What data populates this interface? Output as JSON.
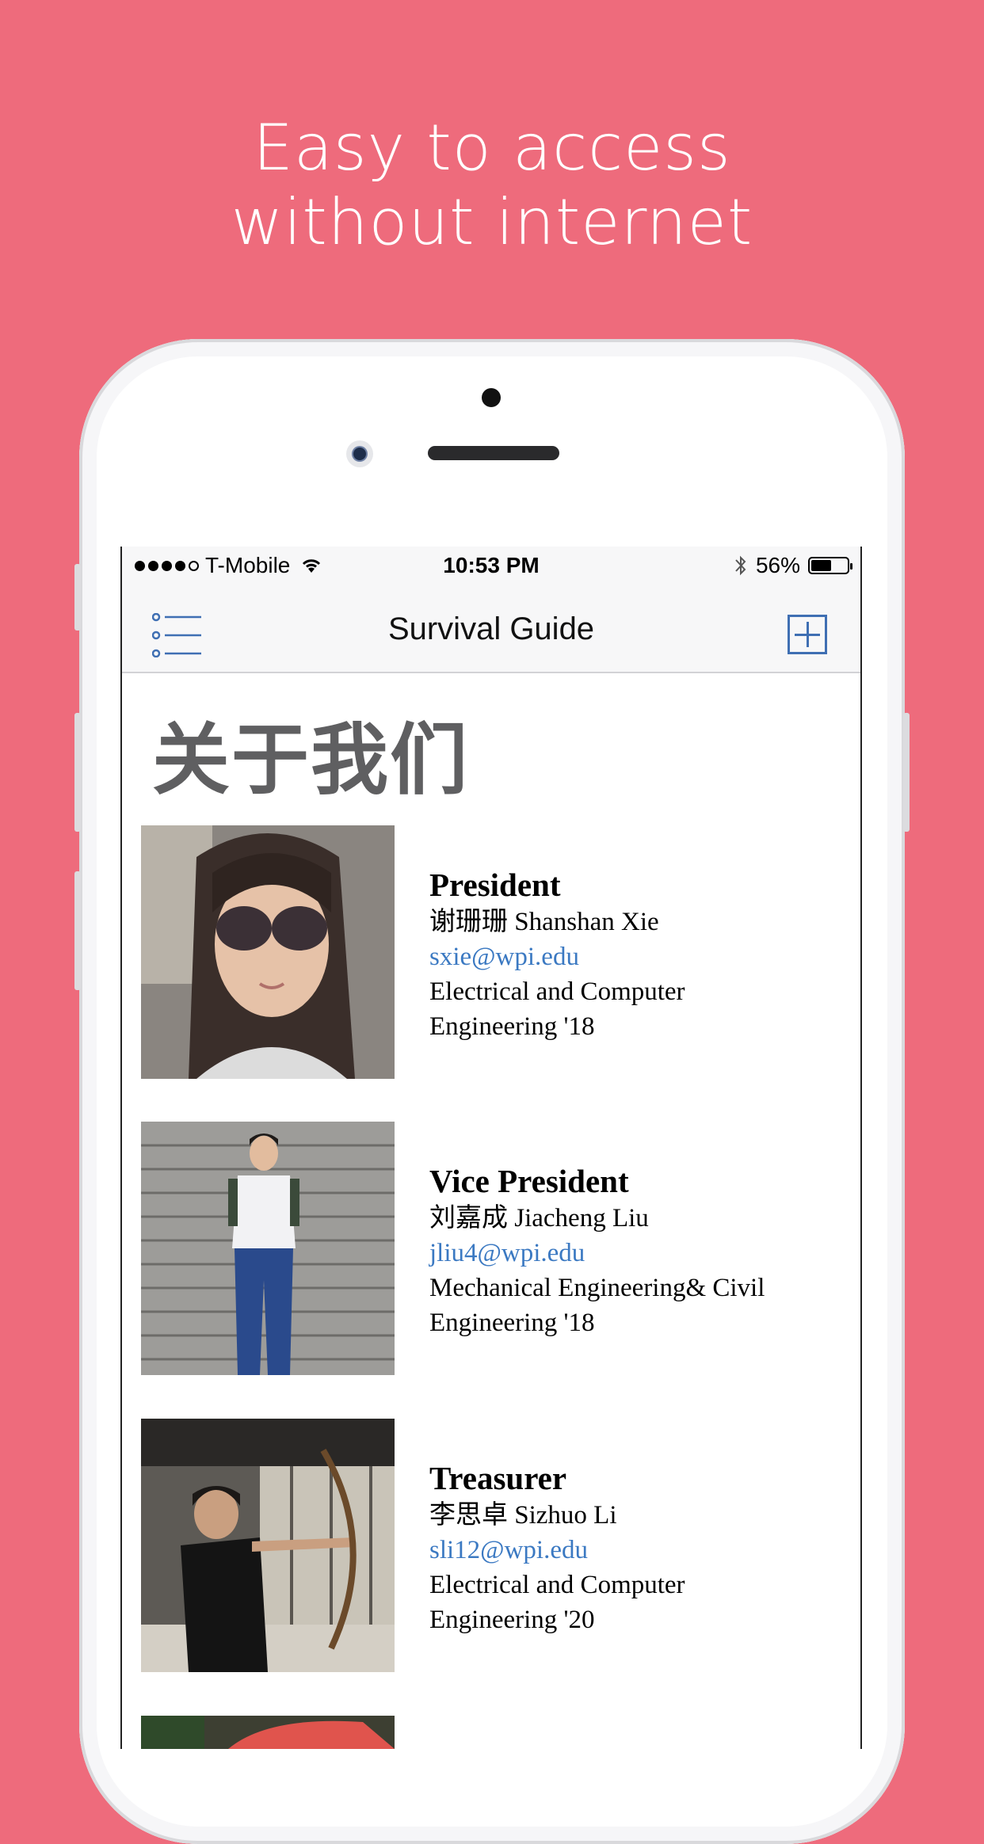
{
  "headline": {
    "line1": "Easy to access",
    "line2": "without internet"
  },
  "status_bar": {
    "carrier": "T-Mobile",
    "time": "10:53 PM",
    "battery_percent": "56%",
    "battery_level": 0.56,
    "signal_bars_filled": 4,
    "signal_bars_total": 5
  },
  "nav": {
    "title": "Survival Guide",
    "left_icon": "list-menu-icon",
    "right_icon": "add-square-icon"
  },
  "page": {
    "title": "关于我们"
  },
  "members": [
    {
      "role": "President",
      "name": "谢珊珊 Shanshan Xie",
      "email": "sxie@wpi.edu",
      "major_line1": "Electrical and Computer",
      "major_line2": "Engineering '18"
    },
    {
      "role": "Vice President",
      "name": "刘嘉成 Jiacheng Liu",
      "email": "jliu4@wpi.edu",
      "major_line1": "Mechanical Engineering& Civil",
      "major_line2": "Engineering '18"
    },
    {
      "role": "Treasurer",
      "name": "李思卓 Sizhuo Li",
      "email": "sli12@wpi.edu",
      "major_line1": "Electrical and Computer",
      "major_line2": "Engineering '20"
    }
  ],
  "colors": {
    "background": "#ee6b7c",
    "link": "#3b79c2",
    "accent": "#3f6fb3"
  }
}
